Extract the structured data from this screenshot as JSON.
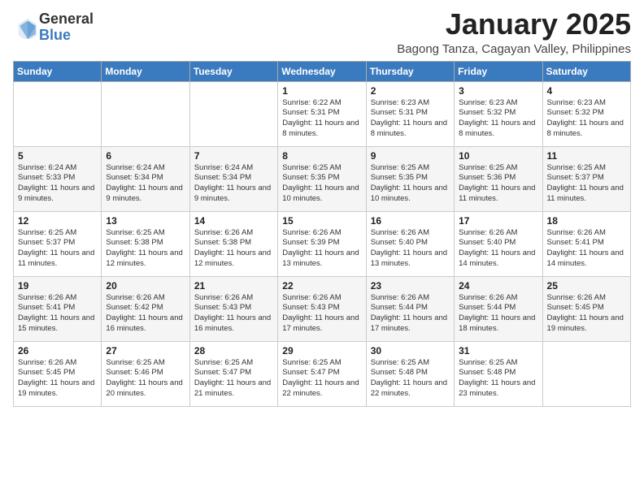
{
  "header": {
    "logo_general": "General",
    "logo_blue": "Blue",
    "month_title": "January 2025",
    "location": "Bagong Tanza, Cagayan Valley, Philippines"
  },
  "days_of_week": [
    "Sunday",
    "Monday",
    "Tuesday",
    "Wednesday",
    "Thursday",
    "Friday",
    "Saturday"
  ],
  "weeks": [
    [
      {
        "day": "",
        "content": ""
      },
      {
        "day": "",
        "content": ""
      },
      {
        "day": "",
        "content": ""
      },
      {
        "day": "1",
        "content": "Sunrise: 6:22 AM\nSunset: 5:31 PM\nDaylight: 11 hours and 8 minutes."
      },
      {
        "day": "2",
        "content": "Sunrise: 6:23 AM\nSunset: 5:31 PM\nDaylight: 11 hours and 8 minutes."
      },
      {
        "day": "3",
        "content": "Sunrise: 6:23 AM\nSunset: 5:32 PM\nDaylight: 11 hours and 8 minutes."
      },
      {
        "day": "4",
        "content": "Sunrise: 6:23 AM\nSunset: 5:32 PM\nDaylight: 11 hours and 8 minutes."
      }
    ],
    [
      {
        "day": "5",
        "content": "Sunrise: 6:24 AM\nSunset: 5:33 PM\nDaylight: 11 hours and 9 minutes."
      },
      {
        "day": "6",
        "content": "Sunrise: 6:24 AM\nSunset: 5:34 PM\nDaylight: 11 hours and 9 minutes."
      },
      {
        "day": "7",
        "content": "Sunrise: 6:24 AM\nSunset: 5:34 PM\nDaylight: 11 hours and 9 minutes."
      },
      {
        "day": "8",
        "content": "Sunrise: 6:25 AM\nSunset: 5:35 PM\nDaylight: 11 hours and 10 minutes."
      },
      {
        "day": "9",
        "content": "Sunrise: 6:25 AM\nSunset: 5:35 PM\nDaylight: 11 hours and 10 minutes."
      },
      {
        "day": "10",
        "content": "Sunrise: 6:25 AM\nSunset: 5:36 PM\nDaylight: 11 hours and 11 minutes."
      },
      {
        "day": "11",
        "content": "Sunrise: 6:25 AM\nSunset: 5:37 PM\nDaylight: 11 hours and 11 minutes."
      }
    ],
    [
      {
        "day": "12",
        "content": "Sunrise: 6:25 AM\nSunset: 5:37 PM\nDaylight: 11 hours and 11 minutes."
      },
      {
        "day": "13",
        "content": "Sunrise: 6:25 AM\nSunset: 5:38 PM\nDaylight: 11 hours and 12 minutes."
      },
      {
        "day": "14",
        "content": "Sunrise: 6:26 AM\nSunset: 5:38 PM\nDaylight: 11 hours and 12 minutes."
      },
      {
        "day": "15",
        "content": "Sunrise: 6:26 AM\nSunset: 5:39 PM\nDaylight: 11 hours and 13 minutes."
      },
      {
        "day": "16",
        "content": "Sunrise: 6:26 AM\nSunset: 5:40 PM\nDaylight: 11 hours and 13 minutes."
      },
      {
        "day": "17",
        "content": "Sunrise: 6:26 AM\nSunset: 5:40 PM\nDaylight: 11 hours and 14 minutes."
      },
      {
        "day": "18",
        "content": "Sunrise: 6:26 AM\nSunset: 5:41 PM\nDaylight: 11 hours and 14 minutes."
      }
    ],
    [
      {
        "day": "19",
        "content": "Sunrise: 6:26 AM\nSunset: 5:41 PM\nDaylight: 11 hours and 15 minutes."
      },
      {
        "day": "20",
        "content": "Sunrise: 6:26 AM\nSunset: 5:42 PM\nDaylight: 11 hours and 16 minutes."
      },
      {
        "day": "21",
        "content": "Sunrise: 6:26 AM\nSunset: 5:43 PM\nDaylight: 11 hours and 16 minutes."
      },
      {
        "day": "22",
        "content": "Sunrise: 6:26 AM\nSunset: 5:43 PM\nDaylight: 11 hours and 17 minutes."
      },
      {
        "day": "23",
        "content": "Sunrise: 6:26 AM\nSunset: 5:44 PM\nDaylight: 11 hours and 17 minutes."
      },
      {
        "day": "24",
        "content": "Sunrise: 6:26 AM\nSunset: 5:44 PM\nDaylight: 11 hours and 18 minutes."
      },
      {
        "day": "25",
        "content": "Sunrise: 6:26 AM\nSunset: 5:45 PM\nDaylight: 11 hours and 19 minutes."
      }
    ],
    [
      {
        "day": "26",
        "content": "Sunrise: 6:26 AM\nSunset: 5:45 PM\nDaylight: 11 hours and 19 minutes."
      },
      {
        "day": "27",
        "content": "Sunrise: 6:25 AM\nSunset: 5:46 PM\nDaylight: 11 hours and 20 minutes."
      },
      {
        "day": "28",
        "content": "Sunrise: 6:25 AM\nSunset: 5:47 PM\nDaylight: 11 hours and 21 minutes."
      },
      {
        "day": "29",
        "content": "Sunrise: 6:25 AM\nSunset: 5:47 PM\nDaylight: 11 hours and 22 minutes."
      },
      {
        "day": "30",
        "content": "Sunrise: 6:25 AM\nSunset: 5:48 PM\nDaylight: 11 hours and 22 minutes."
      },
      {
        "day": "31",
        "content": "Sunrise: 6:25 AM\nSunset: 5:48 PM\nDaylight: 11 hours and 23 minutes."
      },
      {
        "day": "",
        "content": ""
      }
    ]
  ]
}
